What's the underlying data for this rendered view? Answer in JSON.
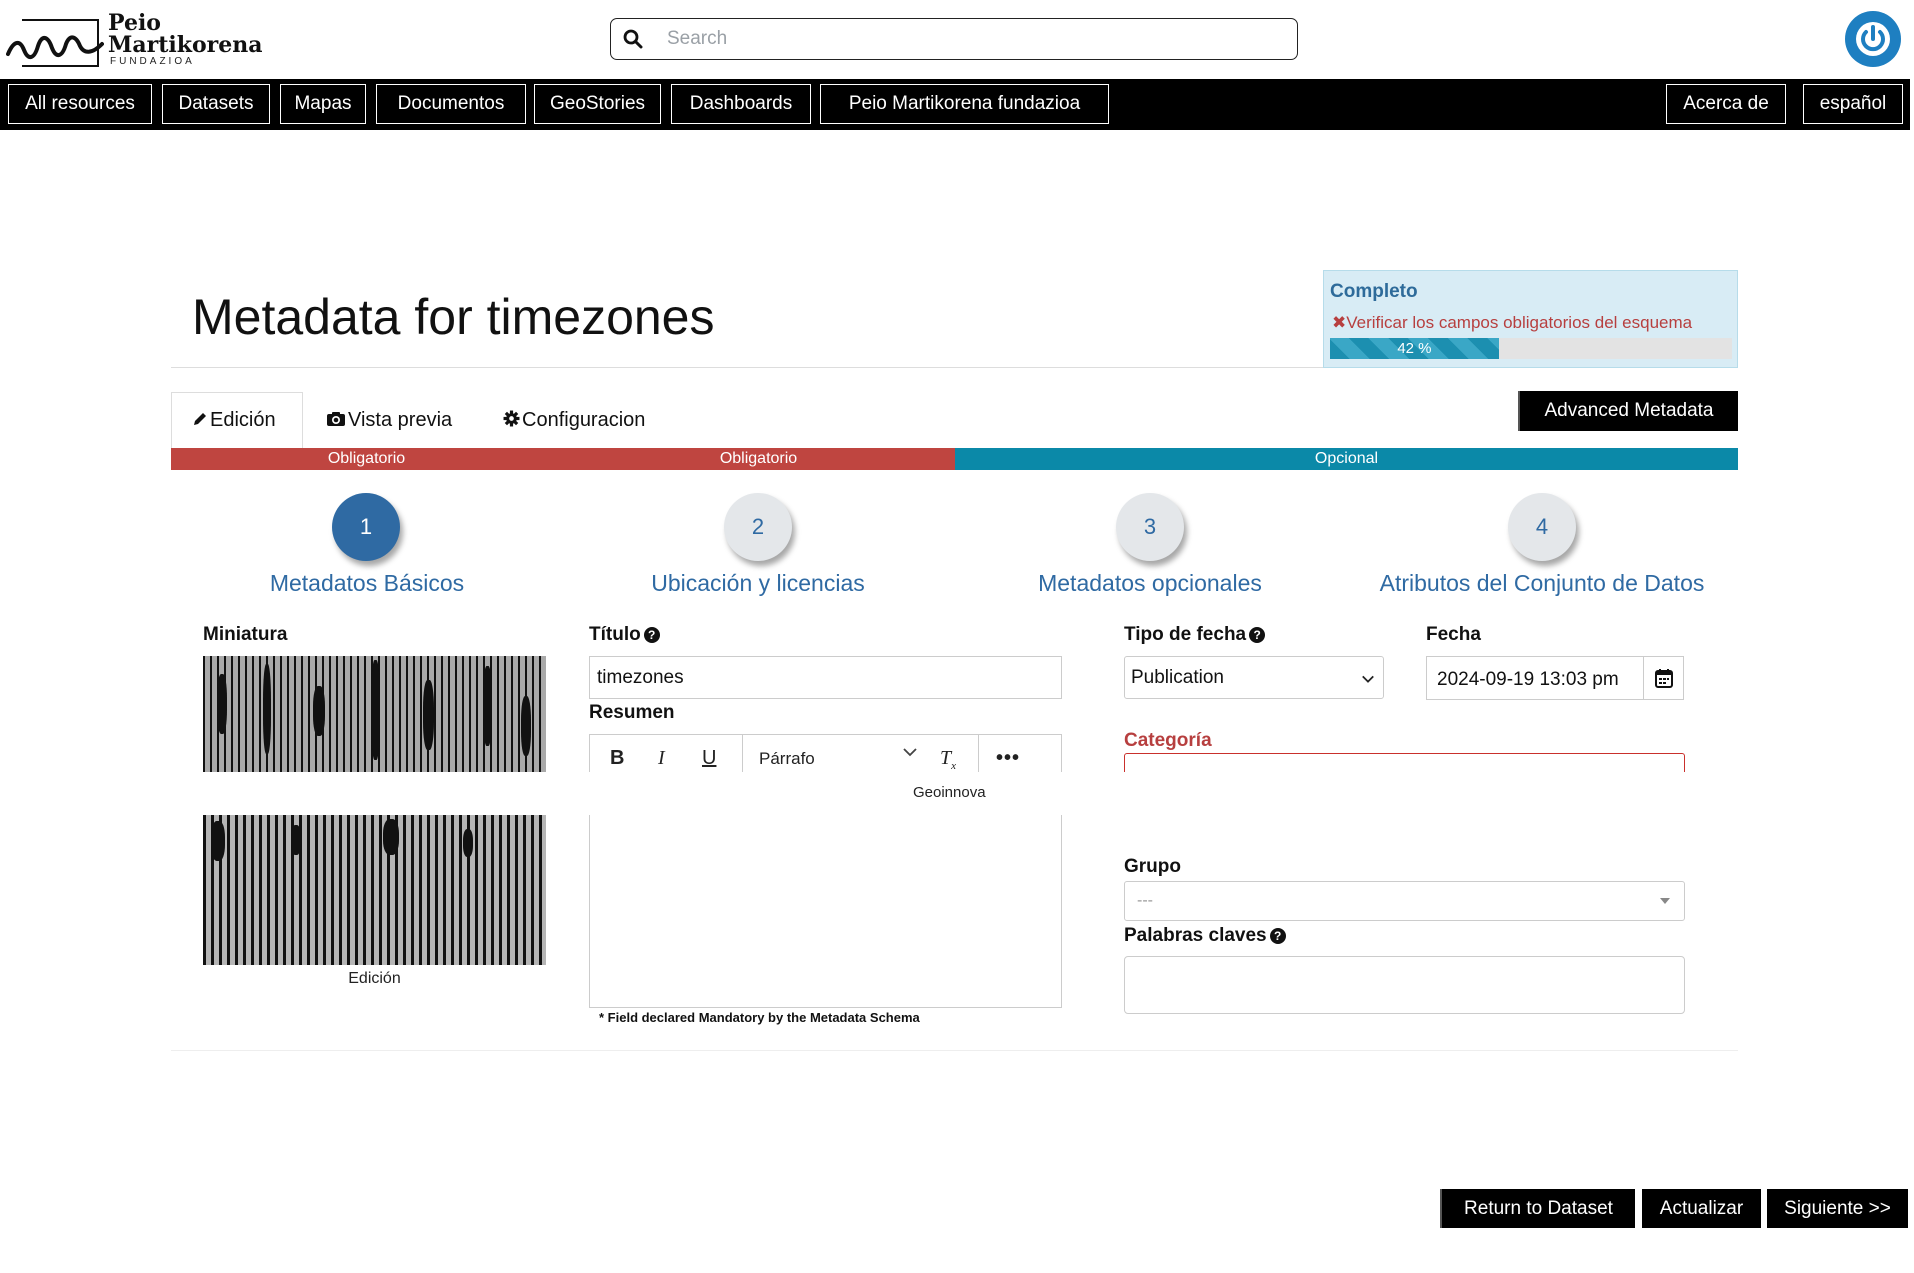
{
  "brand": {
    "line1": "Peio",
    "line2": "Martikorena",
    "line3": "FUNDAZIOA"
  },
  "search": {
    "placeholder": "Search"
  },
  "nav": {
    "left": [
      "All resources",
      "Datasets",
      "Mapas",
      "Documentos",
      "GeoStories",
      "Dashboards",
      "Peio Martikorena fundazioa"
    ],
    "right": [
      "Acerca de",
      "español"
    ]
  },
  "page": {
    "title": "Metadata for timezones"
  },
  "completeness": {
    "title": "Completo",
    "warning": "Verificar los campos obligatorios del esquema",
    "percent": 42,
    "percent_label": "42 %"
  },
  "tabs": {
    "edit": "Edición",
    "preview": "Vista previa",
    "settings": "Configuracion"
  },
  "advanced_button": "Advanced Metadata",
  "stages": [
    "Obligatorio",
    "Obligatorio",
    "Opcional"
  ],
  "colors": {
    "mandatory": "#bf4540",
    "optional": "#0b89a8",
    "step_active": "#2f6aa3",
    "accent": "#1e7fc1"
  },
  "steps": [
    {
      "number": "1",
      "label": "Metadatos Básicos"
    },
    {
      "number": "2",
      "label": "Ubicación y licencias"
    },
    {
      "number": "3",
      "label": "Metadatos opcionales"
    },
    {
      "number": "4",
      "label": "Atributos del Conjunto de Datos"
    }
  ],
  "form": {
    "thumbnail_label": "Miniatura",
    "thumbnail_caption": "Edición",
    "title_label": "Título",
    "title_value": "timezones",
    "abstract_label": "Resumen",
    "format_value": "Párrafo",
    "tooltip": "Geoinnova",
    "mandatory_note": "* Field declared Mandatory by the Metadata Schema",
    "date_type_label": "Tipo de fecha",
    "date_type_value": "Publication",
    "date_label": "Fecha",
    "date_value": "2024-09-19 13:03 pm",
    "category_label": "Categoría",
    "group_label": "Grupo",
    "group_value": "---",
    "keywords_label": "Palabras claves"
  },
  "footer_buttons": [
    "Return to Dataset",
    "Actualizar",
    "Siguiente >>"
  ]
}
